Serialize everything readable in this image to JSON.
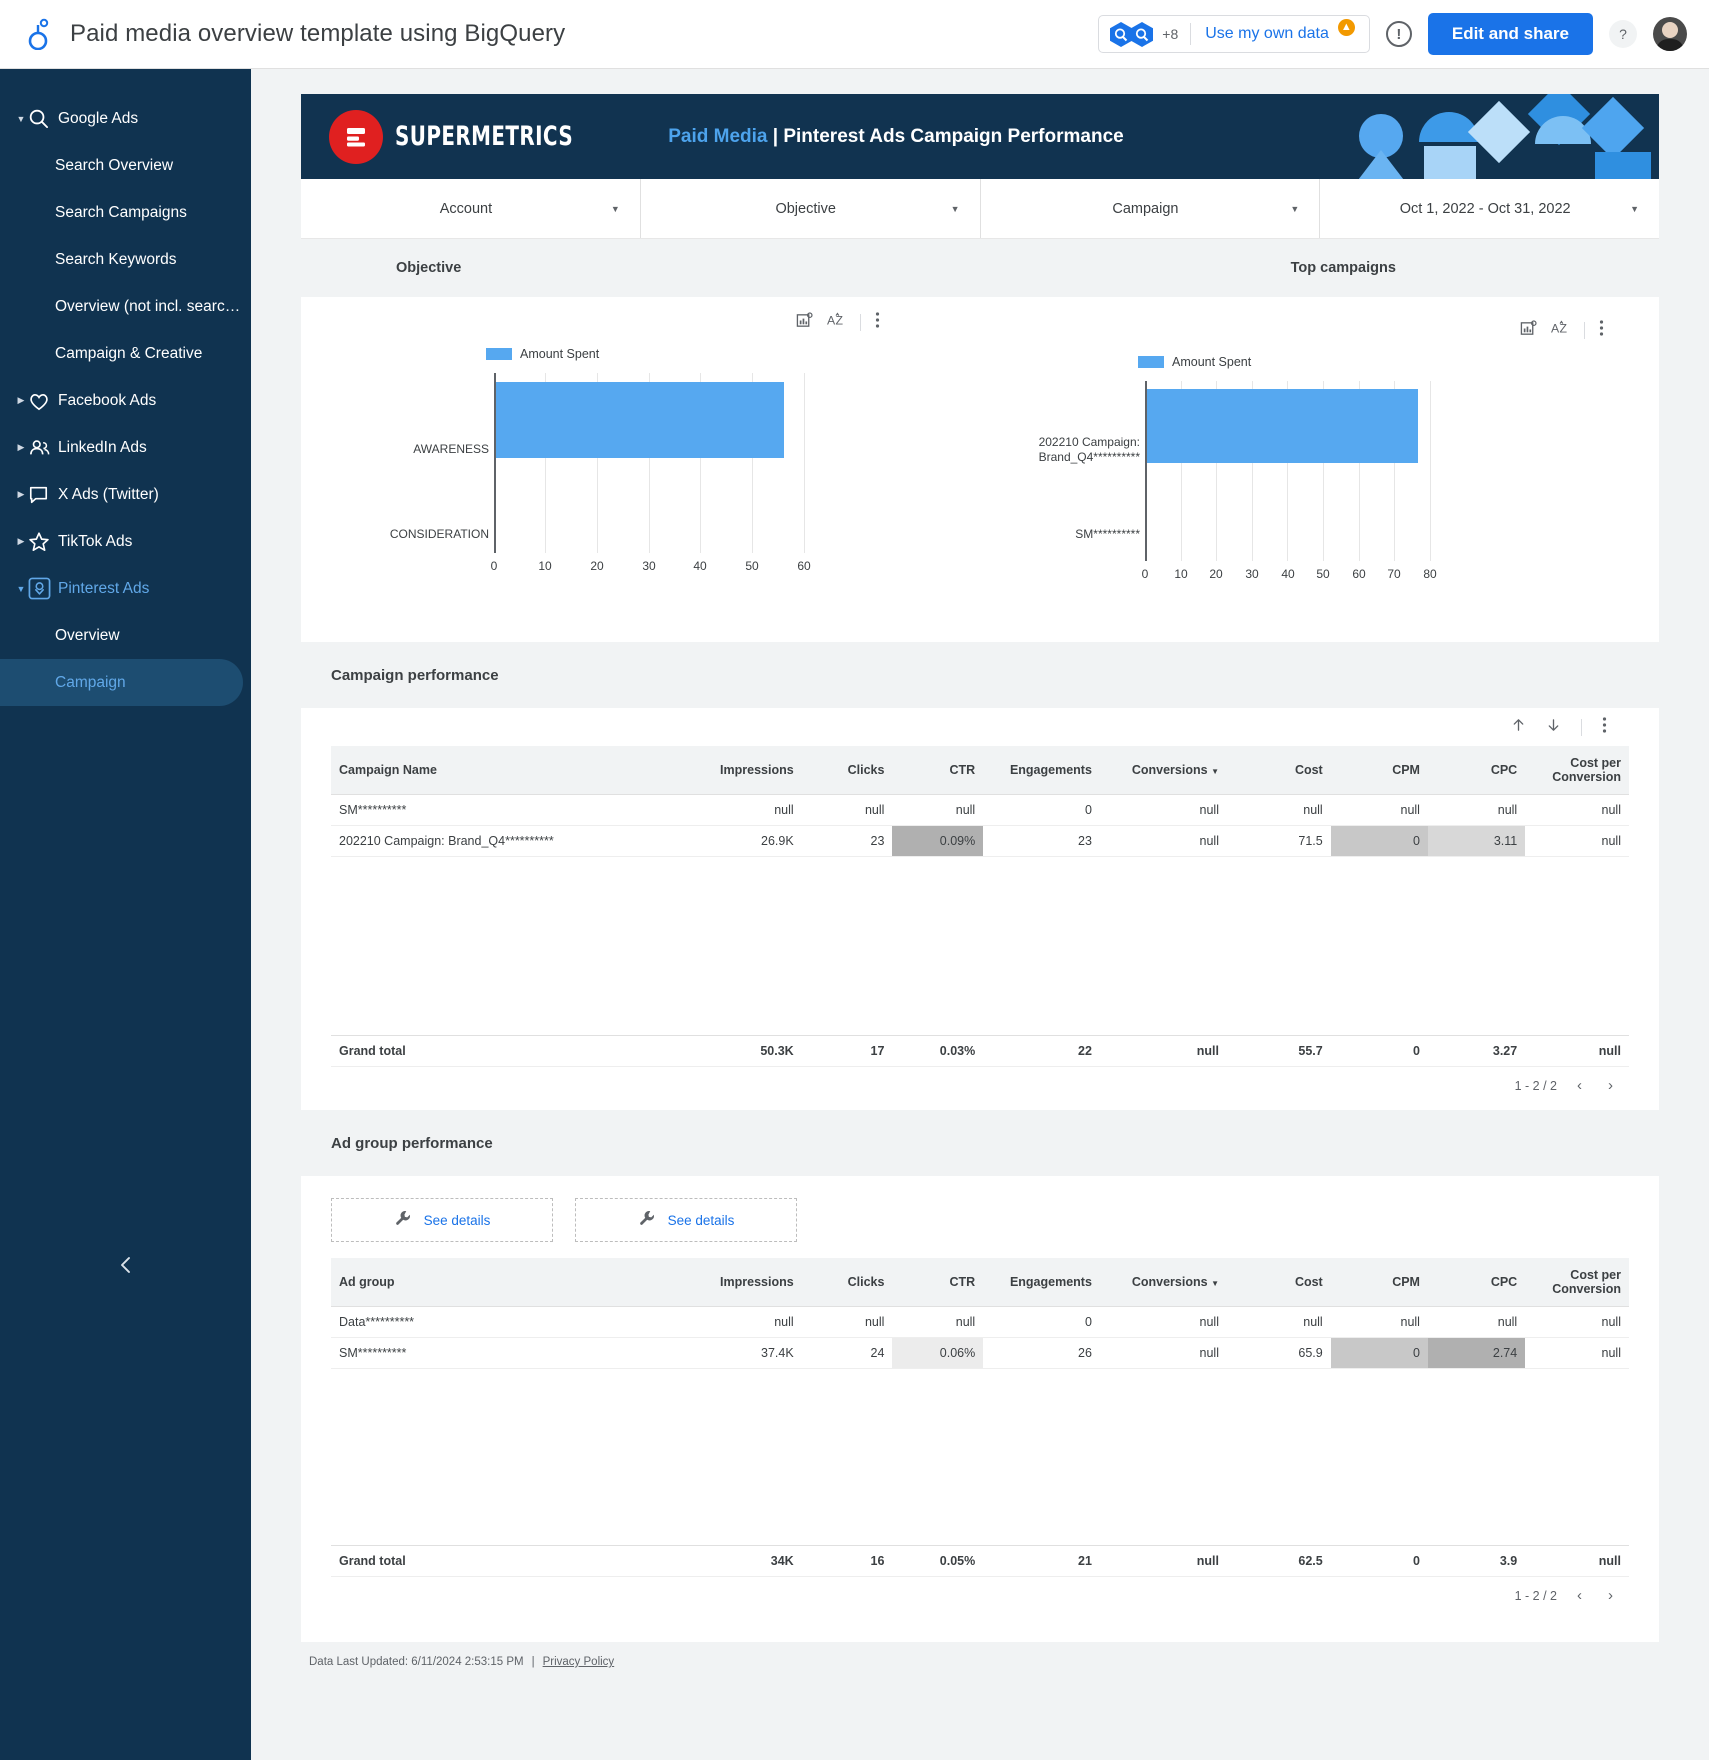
{
  "appbar": {
    "title": "Paid media overview template using BigQuery",
    "logo_icon": "looker-studio-icon",
    "data_sources_extra": "+8",
    "use_own_data": "Use my own data",
    "warning_icon": "warning-triangle-icon",
    "info_icon": "info-circle-icon",
    "edit_share": "Edit and share",
    "help_icon": "question-mark-icon",
    "avatar_icon": "user-avatar"
  },
  "sidebar": {
    "collapse_icon": "chevron-left-icon",
    "groups": [
      {
        "label": "Google Ads",
        "icon": "search-icon",
        "expanded": true,
        "active": false,
        "children": [
          "Search Overview",
          "Search Campaigns",
          "Search Keywords",
          "Overview (not incl. searc…",
          "Campaign & Creative"
        ]
      },
      {
        "label": "Facebook Ads",
        "icon": "heart-icon",
        "expanded": false,
        "active": false,
        "children": []
      },
      {
        "label": "LinkedIn Ads",
        "icon": "people-icon",
        "expanded": false,
        "active": false,
        "children": []
      },
      {
        "label": "X Ads (Twitter)",
        "icon": "chat-bubble-icon",
        "expanded": false,
        "active": false,
        "children": []
      },
      {
        "label": "TikTok Ads",
        "icon": "star-icon",
        "expanded": false,
        "active": false,
        "children": []
      },
      {
        "label": "Pinterest Ads",
        "icon": "pinterest-icon",
        "expanded": true,
        "active": true,
        "children": [
          "Overview",
          "Campaign"
        ],
        "selected_child": "Campaign"
      }
    ]
  },
  "report": {
    "brand": "SUPERMETRICS",
    "brand_logo_icon": "supermetrics-logo",
    "title_prefix": "Paid Media",
    "title_separator": " | ",
    "title_main": "Pinterest Ads Campaign Performance",
    "filters": [
      {
        "label": "Account",
        "arrow_icon": "chevron-down-icon"
      },
      {
        "label": "Objective",
        "arrow_icon": "chevron-down-icon"
      },
      {
        "label": "Campaign",
        "arrow_icon": "chevron-down-icon"
      },
      {
        "label": "Oct 1, 2022 - Oct 31, 2022",
        "arrow_icon": "chevron-down-icon"
      }
    ],
    "sections": {
      "objective_title": "Objective",
      "top_campaigns_title": "Top campaigns",
      "campaign_performance_title": "Campaign performance",
      "adgroup_performance_title": "Ad group performance"
    },
    "chart_tools": {
      "chart_settings_icon": "chart-config-icon",
      "sort_icon": "sort-az-icon",
      "more_icon": "more-vertical-icon"
    },
    "table_tools": {
      "sort_asc_icon": "arrow-up-icon",
      "sort_desc_icon": "arrow-down-icon",
      "more_icon": "more-vertical-icon"
    },
    "detail_buttons": [
      {
        "label": "See details",
        "icon": "wrench-icon"
      },
      {
        "label": "See details",
        "icon": "wrench-icon"
      }
    ],
    "footer": {
      "updated": "Data Last Updated: 6/11/2024 2:53:15 PM",
      "separator": "|",
      "privacy": "Privacy Policy"
    }
  },
  "chart_data": [
    {
      "type": "bar",
      "orientation": "horizontal",
      "title": "Objective",
      "legend": [
        "Amount Spent"
      ],
      "legend_position": "top",
      "categories": [
        "AWARENESS",
        "CONSIDERATION"
      ],
      "series": [
        {
          "name": "Amount Spent",
          "values": [
            55.7,
            0
          ]
        }
      ],
      "xlabel": "",
      "ylabel": "",
      "xlim": [
        0,
        60
      ],
      "xticks": [
        0,
        10,
        20,
        30,
        40,
        50,
        60
      ],
      "grid": true,
      "color": "#56a8f0"
    },
    {
      "type": "bar",
      "orientation": "horizontal",
      "title": "Top campaigns",
      "legend": [
        "Amount Spent"
      ],
      "legend_position": "top",
      "categories": [
        "202210 Campaign: Brand_Q4**********",
        "SM**********"
      ],
      "series": [
        {
          "name": "Amount Spent",
          "values": [
            76,
            0
          ]
        }
      ],
      "xlabel": "",
      "ylabel": "",
      "xlim": [
        0,
        80
      ],
      "xticks": [
        0,
        10,
        20,
        30,
        40,
        50,
        60,
        70,
        80
      ],
      "grid": true,
      "color": "#56a8f0"
    }
  ],
  "campaign_table": {
    "columns": [
      "Campaign Name",
      "Impressions",
      "Clicks",
      "CTR",
      "Engagements",
      "Conversions",
      "Cost",
      "CPM",
      "CPC",
      "Cost per Conversion"
    ],
    "sorted_column": "Conversions",
    "sort_icon": "chevron-down-icon",
    "rows": [
      {
        "cells": [
          "SM**********",
          "null",
          "null",
          "null",
          "0",
          "null",
          "null",
          "null",
          "null",
          "null"
        ]
      },
      {
        "cells": [
          "202210 Campaign: Brand_Q4**********",
          "26.9K",
          "23",
          "0.09%",
          "23",
          "null",
          "71.5",
          "0",
          "3.11",
          "null"
        ]
      }
    ],
    "grand_total": {
      "label": "Grand total",
      "cells": [
        "50.3K",
        "17",
        "0.03%",
        "22",
        "null",
        "55.7",
        "0",
        "3.27",
        "null"
      ]
    },
    "pagination": {
      "range": "1 - 2 / 2",
      "prev_icon": "chevron-left-icon",
      "next_icon": "chevron-right-icon"
    }
  },
  "adgroup_table": {
    "columns": [
      "Ad group",
      "Impressions",
      "Clicks",
      "CTR",
      "Engagements",
      "Conversions",
      "Cost",
      "CPM",
      "CPC",
      "Cost per Conversion"
    ],
    "sorted_column": "Conversions",
    "sort_icon": "chevron-down-icon",
    "rows": [
      {
        "cells": [
          "Data**********",
          "null",
          "null",
          "null",
          "0",
          "null",
          "null",
          "null",
          "null",
          "null"
        ]
      },
      {
        "cells": [
          "SM**********",
          "37.4K",
          "24",
          "0.06%",
          "26",
          "null",
          "65.9",
          "0",
          "2.74",
          "null"
        ]
      }
    ],
    "grand_total": {
      "label": "Grand total",
      "cells": [
        "34K",
        "16",
        "0.05%",
        "21",
        "null",
        "62.5",
        "0",
        "3.9",
        "null"
      ]
    },
    "pagination": {
      "range": "1 - 2 / 2",
      "prev_icon": "chevron-left-icon",
      "next_icon": "chevron-right-icon"
    }
  },
  "colors": {
    "accent": "#1a73e8",
    "sidebar_bg": "#103350",
    "banner_bg": "#113350",
    "chart_bar": "#56a8f0",
    "brand_red": "#e02020",
    "link_blue": "#4da3ec"
  }
}
